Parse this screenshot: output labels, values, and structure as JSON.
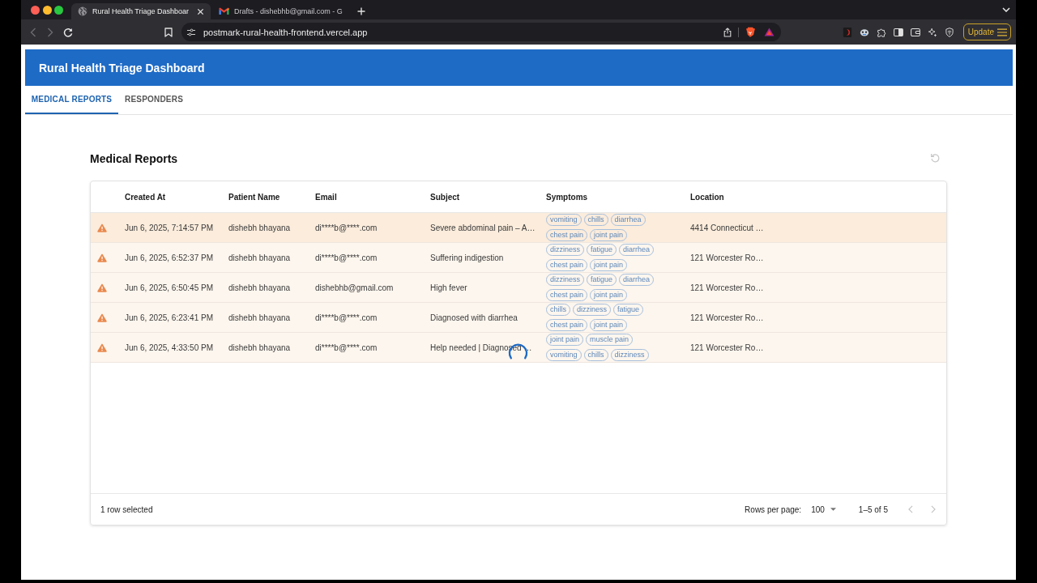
{
  "browser": {
    "tabs": [
      {
        "title": "Rural Health Triage Dashboar",
        "selected": true
      },
      {
        "title": "Drafts - dishebhb@gmail.com - G",
        "selected": false
      }
    ],
    "address": "postmark-rural-health-frontend.vercel.app",
    "update_button": "Update"
  },
  "app": {
    "title": "Rural Health Triage Dashboard",
    "tabs": [
      {
        "label": "MEDICAL REPORTS",
        "selected": true
      },
      {
        "label": "RESPONDERS",
        "selected": false
      }
    ]
  },
  "reports": {
    "title": "Medical Reports",
    "table": {
      "loading": true,
      "columns": [
        "Created At",
        "Patient Name",
        "Email",
        "Subject",
        "Symptoms",
        "Location"
      ],
      "rows": [
        {
          "created_at": "Jun 6, 2025, 7:14:57 PM",
          "patient_name": "dishebh bhayana",
          "email": "di****b@****.com",
          "subject": "Severe abdominal pain – A…",
          "symptoms": [
            "vomiting",
            "chills",
            "diarrhea",
            "chest pain",
            "joint pain"
          ],
          "location": "4414 Connecticut …",
          "selected": true
        },
        {
          "created_at": "Jun 6, 2025, 6:52:37 PM",
          "patient_name": "dishebh bhayana",
          "email": "di****b@****.com",
          "subject": "Suffering indigestion",
          "symptoms": [
            "dizziness",
            "fatigue",
            "diarrhea",
            "chest pain",
            "joint pain"
          ],
          "location": "121 Worcester Ro…",
          "selected": false
        },
        {
          "created_at": "Jun 6, 2025, 6:50:45 PM",
          "patient_name": "dishebh bhayana",
          "email": "dishebhb@gmail.com",
          "subject": "High fever",
          "symptoms": [
            "dizziness",
            "fatigue",
            "diarrhea",
            "chest pain",
            "joint pain"
          ],
          "location": "121 Worcester Ro…",
          "selected": false
        },
        {
          "created_at": "Jun 6, 2025, 6:23:41 PM",
          "patient_name": "dishebh bhayana",
          "email": "di****b@****.com",
          "subject": "Diagnosed with diarrhea",
          "symptoms": [
            "chills",
            "dizziness",
            "fatigue",
            "chest pain",
            "joint pain"
          ],
          "location": "121 Worcester Ro…",
          "selected": false
        },
        {
          "created_at": "Jun 6, 2025, 4:33:50 PM",
          "patient_name": "dishebh bhayana",
          "email": "di****b@****.com",
          "subject": "Help needed | Diagnosed …",
          "symptoms": [
            "joint pain",
            "muscle pain",
            "vomiting",
            "chills",
            "dizziness"
          ],
          "location": "121 Worcester Ro…",
          "selected": false
        }
      ]
    },
    "footer": {
      "selection": "1 row selected",
      "rows_per_page_label": "Rows per page:",
      "rows_per_page": "100",
      "range": "1–5 of 5"
    }
  }
}
